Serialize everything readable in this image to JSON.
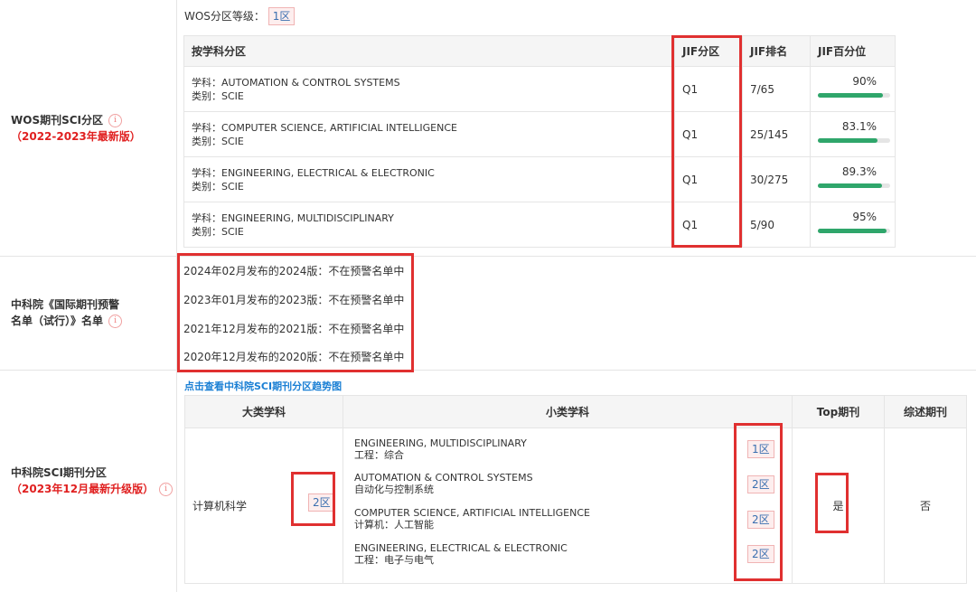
{
  "wos": {
    "grade_label": "WOS分区等级：",
    "grade_value": "1区",
    "section_title": "WOS期刊SCI分区",
    "section_subtitle": "（2022-2023年最新版）",
    "headers": [
      "按学科分区",
      "JIF分区",
      "JIF排名",
      "JIF百分位"
    ],
    "rows": [
      {
        "subject": "学科：AUTOMATION & CONTROL SYSTEMS",
        "category": "类别：SCIE",
        "quartile": "Q1",
        "rank": "7/65",
        "percentile": "90%",
        "percentile_value": 90
      },
      {
        "subject": "学科：COMPUTER SCIENCE, ARTIFICIAL INTELLIGENCE",
        "category": "类别：SCIE",
        "quartile": "Q1",
        "rank": "25/145",
        "percentile": "83.1%",
        "percentile_value": 83.1
      },
      {
        "subject": "学科：ENGINEERING, ELECTRICAL & ELECTRONIC",
        "category": "类别：SCIE",
        "quartile": "Q1",
        "rank": "30/275",
        "percentile": "89.3%",
        "percentile_value": 89.3
      },
      {
        "subject": "学科：ENGINEERING, MULTIDISCIPLINARY",
        "category": "类别：SCIE",
        "quartile": "Q1",
        "rank": "5/90",
        "percentile": "95%",
        "percentile_value": 95
      }
    ]
  },
  "warning": {
    "section_title_line1": "中科院《国际期刊预警",
    "section_title_line2": "名单（试行）》名单",
    "items": [
      "2024年02月发布的2024版：不在预警名单中",
      "2023年01月发布的2023版：不在预警名单中",
      "2021年12月发布的2021版：不在预警名单中",
      "2020年12月发布的2020版：不在预警名单中"
    ]
  },
  "cas": {
    "section_title": "中科院SCI期刊分区",
    "section_subtitle": "（2023年12月最新升级版）",
    "trend_link": "点击查看中科院SCI期刊分区趋势图",
    "headers": [
      "大类学科",
      "小类学科",
      "Top期刊",
      "综述期刊"
    ],
    "major_subject": "计算机科学",
    "major_zone": "2区",
    "minor": [
      {
        "en": "ENGINEERING, MULTIDISCIPLINARY",
        "cn": "工程：综合",
        "zone": "1区"
      },
      {
        "en": "AUTOMATION & CONTROL SYSTEMS",
        "cn": "自动化与控制系统",
        "zone": "2区"
      },
      {
        "en": "COMPUTER SCIENCE, ARTIFICIAL INTELLIGENCE",
        "cn": "计算机：人工智能",
        "zone": "2区"
      },
      {
        "en": "ENGINEERING, ELECTRICAL & ELECTRONIC",
        "cn": "工程：电子与电气",
        "zone": "2区"
      }
    ],
    "top_journal": "是",
    "review_journal": "否"
  },
  "colors": {
    "accent_red": "#e03030",
    "progress_green": "#2fa66b",
    "link_blue": "#1a7fd4"
  },
  "icons": {
    "info": "info-circle-icon"
  }
}
